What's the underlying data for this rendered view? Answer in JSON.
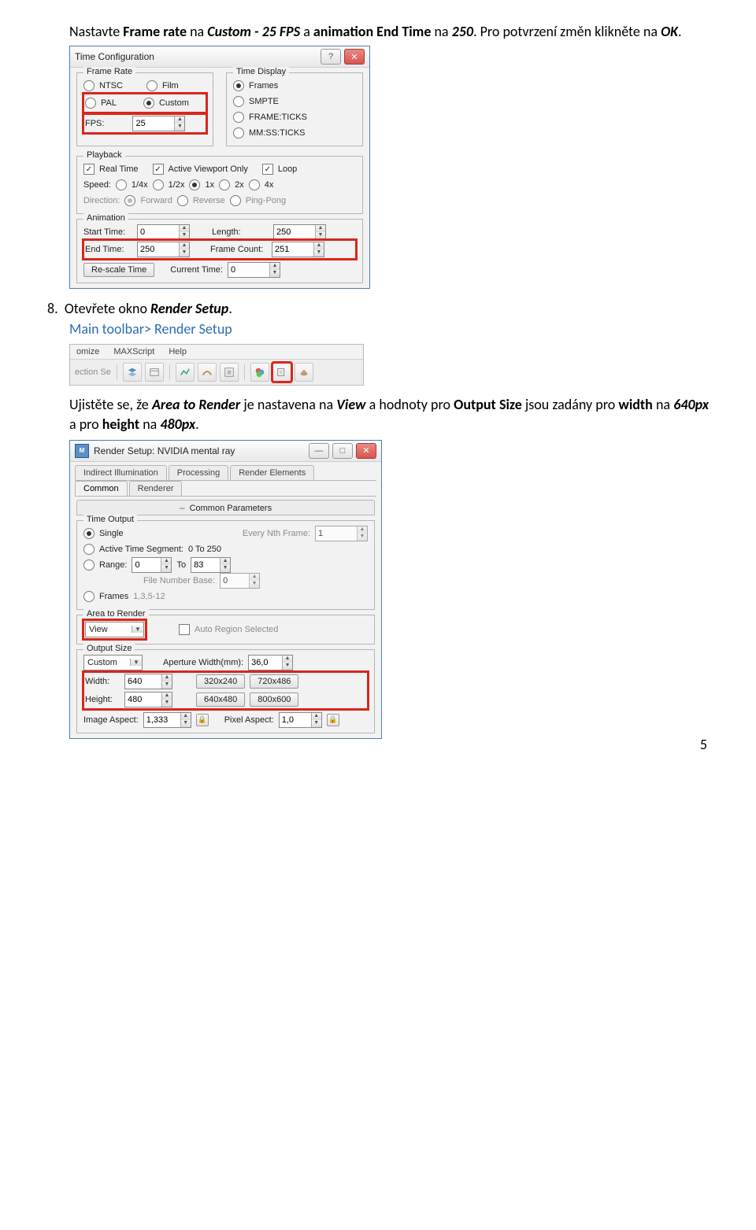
{
  "doc": {
    "intro_pre": "Nastavte ",
    "intro_b1": "Frame rate",
    "intro_mid1": " na ",
    "intro_ib1": "Custom - 25 FPS",
    "intro_mid2": " a ",
    "intro_b2": "animation End Time",
    "intro_mid3": " na ",
    "intro_ib2": "250",
    "intro_post": ". Pro potvrzení změn klikněte na ",
    "intro_ib3": "OK",
    "intro_dot": ".",
    "step8_num": "8.",
    "step8_pre": "Otevřete okno ",
    "step8_ib": "Render Setup",
    "step8_dot": ".",
    "step8_path": "Main toolbar> Render Setup",
    "p3_pre": "Ujistěte se, že ",
    "p3_ib1": "Area to Render",
    "p3_mid1": " je nastavena na ",
    "p3_ib2": "View",
    "p3_mid2": " a hodnoty pro ",
    "p3_b1": "Output Size",
    "p3_mid3": " jsou zadány pro ",
    "p3_b2": "width",
    "p3_mid4": " na ",
    "p3_ib3": "640px",
    "p3_mid5": " a pro ",
    "p3_b3": "height",
    "p3_mid6": " na ",
    "p3_ib4": "480px",
    "p3_dot": ".",
    "page_number": "5"
  },
  "tc": {
    "title": "Time Configuration",
    "help": "?",
    "close": "✕",
    "frame_rate": {
      "legend": "Frame Rate",
      "ntsc": "NTSC",
      "film": "Film",
      "pal": "PAL",
      "custom": "Custom",
      "fps_label": "FPS:",
      "fps_value": "25"
    },
    "time_display": {
      "legend": "Time Display",
      "frames": "Frames",
      "smpte": "SMPTE",
      "frame_ticks": "FRAME:TICKS",
      "mmssticks": "MM:SS:TICKS"
    },
    "playback": {
      "legend": "Playback",
      "real_time": "Real Time",
      "avo": "Active Viewport Only",
      "loop": "Loop",
      "speed": "Speed:",
      "s14": "1/4x",
      "s12": "1/2x",
      "s1": "1x",
      "s2": "2x",
      "s4": "4x",
      "direction": "Direction:",
      "fwd": "Forward",
      "rev": "Reverse",
      "pp": "Ping-Pong"
    },
    "animation": {
      "legend": "Animation",
      "start": "Start Time:",
      "start_v": "0",
      "length": "Length:",
      "length_v": "250",
      "end": "End Time:",
      "end_v": "250",
      "fc": "Frame Count:",
      "fc_v": "251",
      "rescale": "Re-scale Time",
      "ct": "Current Time:",
      "ct_v": "0"
    }
  },
  "tb": {
    "menu": {
      "m1": "omize",
      "m2": "MAXScript",
      "m3": "Help"
    },
    "left": "ection Se"
  },
  "rs": {
    "title": "Render Setup: NVIDIA mental ray",
    "min": "—",
    "max": "□",
    "close": "✕",
    "tabs_top": {
      "t1": "Indirect Illumination",
      "t2": "Processing",
      "t3": "Render Elements"
    },
    "tabs_bot": {
      "t1": "Common",
      "t2": "Renderer"
    },
    "section": "Common Parameters",
    "time_output": {
      "legend": "Time Output",
      "single": "Single",
      "enf": "Every Nth Frame:",
      "enf_v": "1",
      "ats": "Active Time Segment:",
      "ats_r": "0 To 250",
      "range": "Range:",
      "range_a": "0",
      "to": "To",
      "range_b": "83",
      "fnb": "File Number Base:",
      "fnb_v": "0",
      "frames": "Frames",
      "frames_v": "1,3,5-12"
    },
    "atr": {
      "legend": "Area to Render",
      "value": "View",
      "auto": "Auto Region Selected"
    },
    "out": {
      "legend": "Output Size",
      "custom": "Custom",
      "aw": "Aperture Width(mm):",
      "aw_v": "36,0",
      "width": "Width:",
      "width_v": "640",
      "height": "Height:",
      "height_v": "480",
      "p1": "320x240",
      "p2": "720x486",
      "p3": "640x480",
      "p4": "800x600",
      "ia": "Image Aspect:",
      "ia_v": "1,333",
      "pa": "Pixel Aspect:",
      "pa_v": "1,0"
    }
  }
}
